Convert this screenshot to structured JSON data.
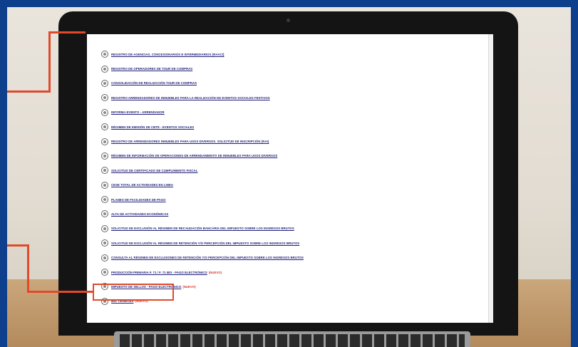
{
  "menu": {
    "items": [
      {
        "label": "REGISTRO DE AGENCIAS, CONCESIONARIOS E INTERMEDIARIOS (RAACI)"
      },
      {
        "label": "REGISTRO DE OPERADORES DE TOUR DE COMPRAS"
      },
      {
        "label": "CONSOLIDACIÓN DE REALIZACIÓN TOUR DE COMPRAS"
      },
      {
        "label": "REGISTRO ARRENDADORES DE INMUEBLES PARA LA REALIZACIÓN DE EVENTOS SOCIALES FESTIVOS"
      },
      {
        "label": "INFORMA EVENTO - ARRENDADOR"
      },
      {
        "label": "RÉGIMEN DE EMISIÓN DE CBTE - EVENTOS SOCIALES"
      },
      {
        "label": "REGISTRO DE ARRENDADORES INMUEBLES PARA USOS DIVERSOS. SOLICITUD DE INSCRIPCIÓN (RAI)"
      },
      {
        "label": "RÉGIMEN DE INFORMACIÓN DE OPERACIONES DE ARRENDAMIENTO DE INMUEBLES PARA USOS DIVERSOS"
      },
      {
        "label": "SOLICITUD DE CERTIFICADO DE CUMPLIMIENTO FISCAL"
      },
      {
        "label": "CESE TOTAL DE ACTIVIDADES EN LINEA"
      },
      {
        "label": "PLANES DE FACILIDADES DE PAGO"
      },
      {
        "label": "ALTA DE ACTIVIDADES ECONÓMICAS"
      },
      {
        "label": "SOLICITUD DE EXCLUSIÓN AL RÉGIMEN DE RECAUDACIÓN BANCARIA DEL IMPUESTO SOBRE LOS INGRESOS BRUTOS"
      },
      {
        "label": "SOLICITUD DE EXCLUSIÓN AL RÉGIMEN DE RETENCIÓN Y/O PERCEPCIÓN DEL IMPUESTO SOBRE LOS INGRESOS BRUTOS"
      },
      {
        "label": "CONSULTA AL RÉGIMEN DE EXCLUSIONES DE RETENCIÓN Y/O PERCEPCIÓN DEL IMPUESTO SOBRE LOS INGRESOS BRUTOS"
      },
      {
        "label": "PRODUCCIÓN PRIMARIA F. 71 / F. 71 BIS - PAGO ELECTRÓNICO",
        "badge": "(NUEVO)"
      },
      {
        "label": "IMPUESTO DE SELLOS - PAGO ELECTRÓNICO",
        "badge": "(NUEVO)"
      },
      {
        "label": "MIS TRÁMITES",
        "badge": "(NUEVO)"
      }
    ]
  },
  "colors": {
    "frame": "#0d3f8c",
    "link": "#1f1f7a",
    "badge": "#d93a3a",
    "highlight": "#e04a2a"
  },
  "icons": {
    "item": "radio-circle-icon",
    "camera": "camera-icon"
  }
}
